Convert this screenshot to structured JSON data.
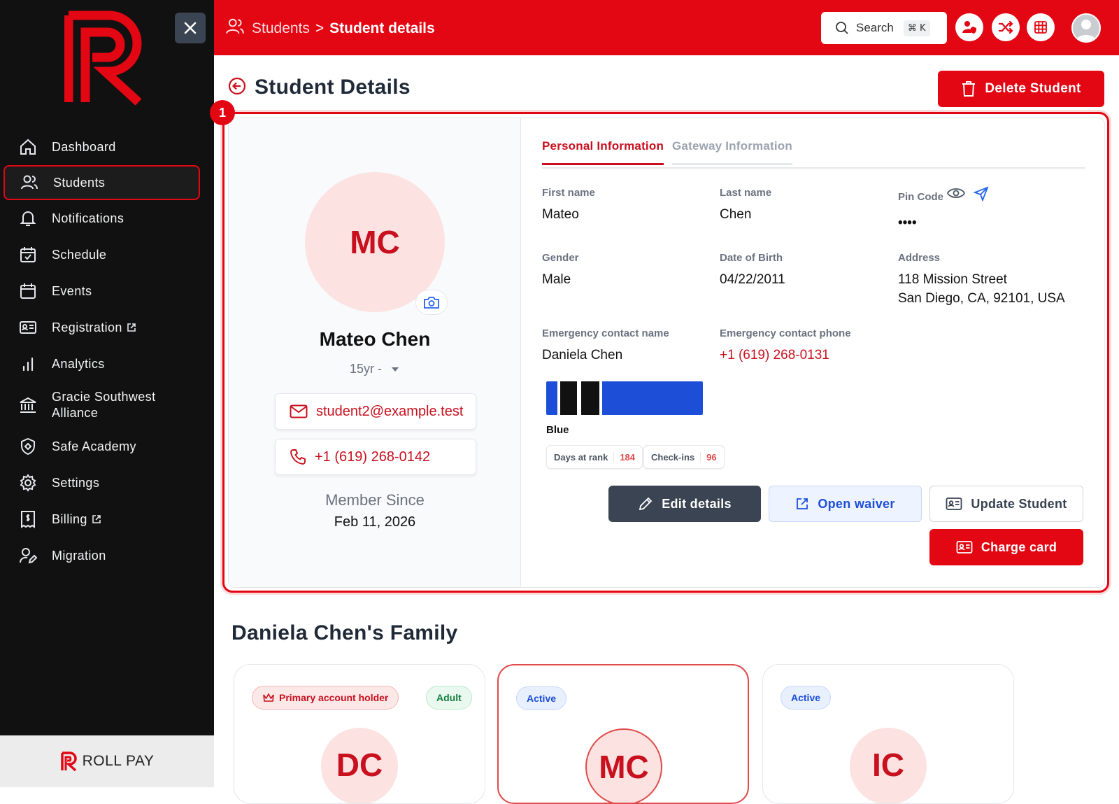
{
  "brand": {
    "name": "ROLL PAY",
    "accent": "#e30613"
  },
  "sidebar": {
    "items": [
      {
        "label": "Dashboard",
        "icon": "home-icon"
      },
      {
        "label": "Students",
        "icon": "users-icon",
        "active": true
      },
      {
        "label": "Notifications",
        "icon": "bell-icon"
      },
      {
        "label": "Schedule",
        "icon": "calendar-check-icon"
      },
      {
        "label": "Events",
        "icon": "calendar-icon"
      },
      {
        "label": "Registration",
        "icon": "id-card-icon",
        "external": true
      },
      {
        "label": "Analytics",
        "icon": "bar-chart-icon"
      },
      {
        "label": "Gracie Southwest Alliance",
        "icon": "bank-icon"
      },
      {
        "label": "Safe Academy",
        "icon": "shield-icon"
      },
      {
        "label": "Settings",
        "icon": "gear-icon"
      },
      {
        "label": "Billing",
        "icon": "receipt-icon",
        "external": true
      },
      {
        "label": "Migration",
        "icon": "user-edit-icon"
      }
    ]
  },
  "topbar": {
    "breadcrumb": {
      "parent": "Students",
      "sep": ">",
      "current": "Student details"
    },
    "search": {
      "label": "Search",
      "shortcut": "⌘ K"
    }
  },
  "page": {
    "title": "Student Details",
    "delete_label": "Delete Student",
    "marker": "1"
  },
  "student": {
    "initials": "MC",
    "name": "Mateo Chen",
    "age": "15yr -",
    "email": "student2@example.test",
    "phone": "+1 (619) 268-0142",
    "member_since_label": "Member Since",
    "member_since": "Feb 11, 2026"
  },
  "tabs": [
    {
      "label": "Personal Information",
      "active": true
    },
    {
      "label": "Gateway Information",
      "active": false
    }
  ],
  "fields": {
    "first_name_label": "First name",
    "first_name": "Mateo",
    "last_name_label": "Last name",
    "last_name": "Chen",
    "pin_label": "Pin Code",
    "pin": "••••",
    "gender_label": "Gender",
    "gender": "Male",
    "dob_label": "Date of Birth",
    "dob": "04/22/2011",
    "address_label": "Address",
    "address_line1": "118 Mission Street",
    "address_line2": "San Diego, CA, 92101, USA",
    "ec_name_label": "Emergency contact name",
    "ec_name": "Daniela Chen",
    "ec_phone_label": "Emergency contact phone",
    "ec_phone": "+1 (619) 268-0131"
  },
  "rank": {
    "belt": "Blue",
    "belt_color": "#1d4ed8",
    "stripes": 2,
    "days_label": "Days at rank",
    "days": "184",
    "checkins_label": "Check-ins",
    "checkins": "96"
  },
  "actions": {
    "edit": "Edit details",
    "waiver": "Open waiver",
    "update": "Update Student",
    "charge": "Charge card"
  },
  "family": {
    "title": "Daniela Chen's Family",
    "members": [
      {
        "initials": "DC",
        "badges": [
          "Primary account holder",
          "Adult"
        ]
      },
      {
        "initials": "MC",
        "badges": [
          "Active"
        ],
        "selected": true
      },
      {
        "initials": "IC",
        "badges": [
          "Active"
        ]
      }
    ]
  }
}
